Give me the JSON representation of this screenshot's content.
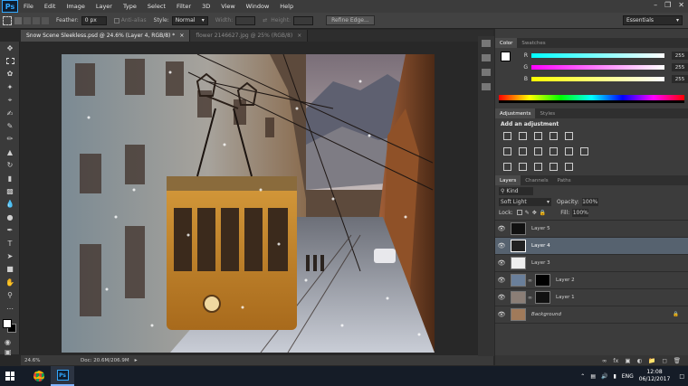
{
  "menubar": {
    "logo": "Ps",
    "items": [
      "File",
      "Edit",
      "Image",
      "Layer",
      "Type",
      "Select",
      "Filter",
      "3D",
      "View",
      "Window",
      "Help"
    ]
  },
  "options": {
    "feather_label": "Feather:",
    "feather_value": "0 px",
    "antialias_label": "Anti-alias",
    "style_label": "Style:",
    "style_value": "Normal",
    "width_label": "Width:",
    "height_label": "Height:",
    "refine_edge": "Refine Edge...",
    "workspace": "Essentials"
  },
  "tabs": [
    "Snow Scene Sleekless.psd @ 24.6% (Layer 4, RGB/8) *",
    "flower 2146627.jpg @ 25% (RGB/8)"
  ],
  "status": {
    "zoom": "24.6%",
    "doc": "Doc: 20.6M/206.9M"
  },
  "color_panel": {
    "tabs": [
      "Color",
      "Swatches"
    ],
    "sliders": [
      {
        "label": "R",
        "value": "255"
      },
      {
        "label": "G",
        "value": "255"
      },
      {
        "label": "B",
        "value": "255"
      }
    ]
  },
  "adjustments_panel": {
    "tabs": [
      "Adjustments",
      "Styles"
    ],
    "title": "Add an adjustment"
  },
  "layers_panel": {
    "tabs": [
      "Layers",
      "Channels",
      "Paths"
    ],
    "filter_kind": "Kind",
    "blend_mode": "Soft Light",
    "opacity_label": "Opacity:",
    "opacity_value": "100%",
    "lock_label": "Lock:",
    "fill_label": "Fill:",
    "fill_value": "100%",
    "layers": [
      {
        "name": "Layer 5",
        "selected": false,
        "mask": false
      },
      {
        "name": "Layer 4",
        "selected": true,
        "mask": false
      },
      {
        "name": "Layer 3",
        "selected": false,
        "mask": false
      },
      {
        "name": "Layer 2",
        "selected": false,
        "mask": true
      },
      {
        "name": "Layer 1",
        "selected": false,
        "mask": true
      },
      {
        "name": "Background",
        "selected": false,
        "mask": false,
        "locked": true
      }
    ]
  },
  "taskbar": {
    "lang": "ENG",
    "time": "12:08",
    "date": "06/12/2017"
  },
  "colors": {
    "accent_selected": "#56626f",
    "ps_blue": "#31a8ff"
  }
}
